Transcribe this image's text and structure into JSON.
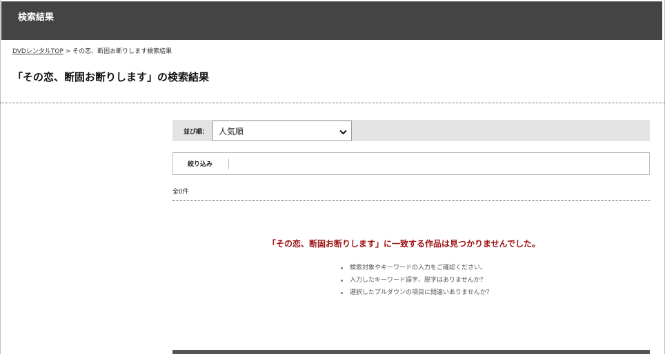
{
  "header": {
    "title": "検索結果"
  },
  "breadcrumb": {
    "home": "DVDレンタルTOP",
    "separator": ">",
    "current": "その恋、断固お断りします検索結果"
  },
  "page_title": "「その恋、断固お断りします」の検索結果",
  "sort": {
    "label": "並び順：",
    "selected": "人気順"
  },
  "filter": {
    "label": "絞り込み"
  },
  "result_count": "全0件",
  "no_result": {
    "message": "「その恋、断固お断りします」に一致する作品は見つかりませんでした。",
    "hints": [
      "検索対象やキーワードの入力をご確認ください。",
      "入力したキーワード誤字、脱字はありませんか？",
      "選択したプルダウンの項目に間違いありませんか？"
    ]
  },
  "colors": {
    "header_bg": "#444444",
    "sort_bar_bg": "#e4e4e4",
    "no_result_text": "#9b1010"
  }
}
